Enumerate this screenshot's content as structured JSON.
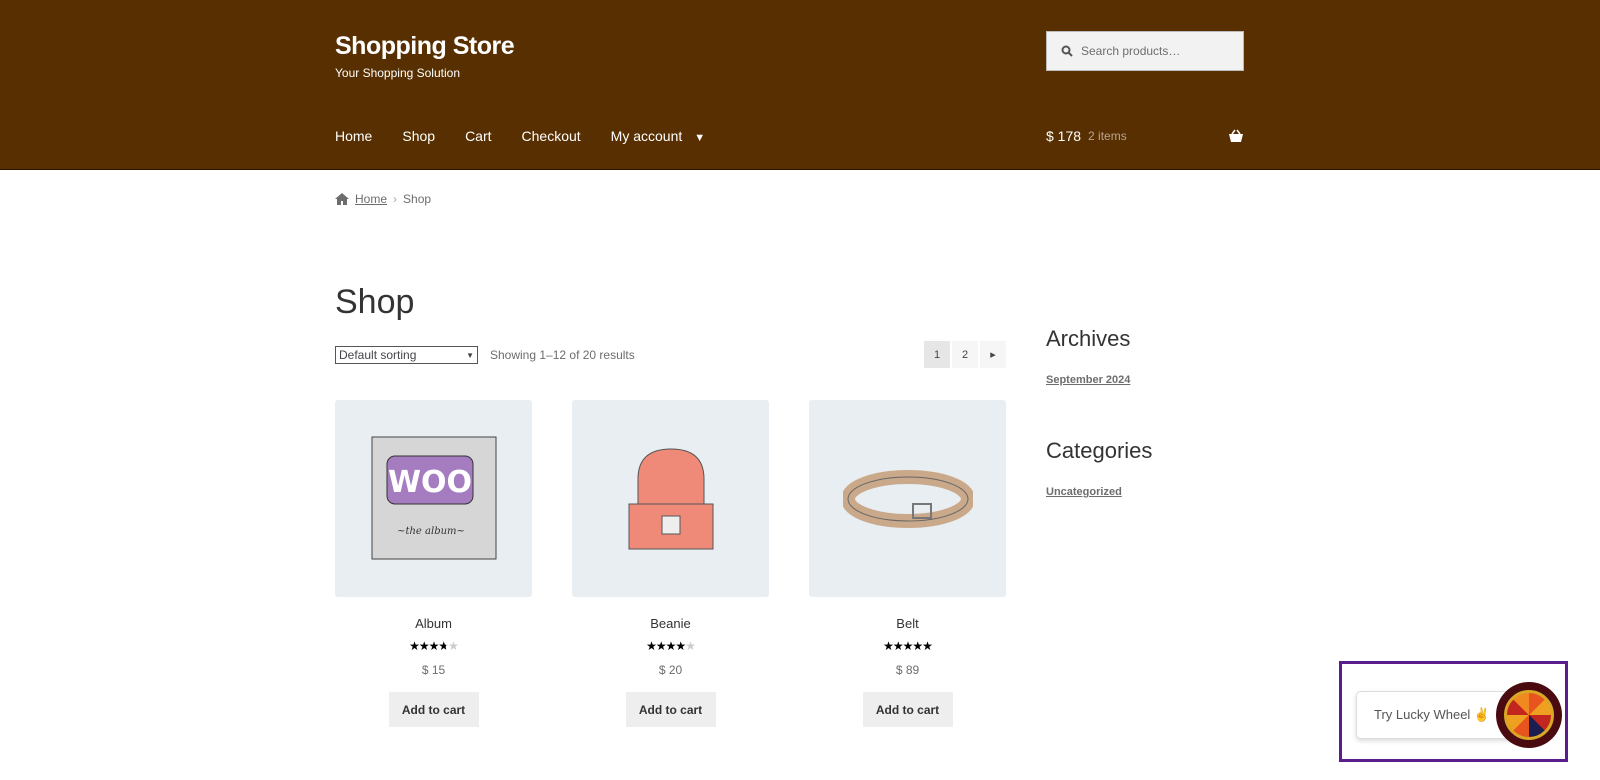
{
  "site": {
    "title": "Shopping Store",
    "tagline": "Your Shopping Solution",
    "header_color": "#582f00"
  },
  "search": {
    "placeholder": "Search products…"
  },
  "nav": [
    {
      "label": "Home"
    },
    {
      "label": "Shop"
    },
    {
      "label": "Cart"
    },
    {
      "label": "Checkout"
    },
    {
      "label": "My account"
    }
  ],
  "cart": {
    "total": "$ 178",
    "items": "2 items"
  },
  "breadcrumb": {
    "home": "Home",
    "current": "Shop"
  },
  "page": {
    "title": "Shop",
    "sort": "Default sorting",
    "results": "Showing 1–12 of 20 results",
    "pages": [
      "1",
      "2"
    ],
    "current_page": "1"
  },
  "products": [
    {
      "name": "Album",
      "rating": 3.75,
      "price": "$ 15",
      "button": "Add to cart"
    },
    {
      "name": "Beanie",
      "rating": 4,
      "price": "$ 20",
      "button": "Add to cart"
    },
    {
      "name": "Belt",
      "rating": 5,
      "price": "$ 89",
      "button": "Add to cart"
    }
  ],
  "sidebar": {
    "archives_title": "Archives",
    "archives": [
      "September 2024"
    ],
    "categories_title": "Categories",
    "categories": [
      "Uncategorized"
    ]
  },
  "lucky_wheel": {
    "label": "Try Lucky Wheel ✌"
  }
}
